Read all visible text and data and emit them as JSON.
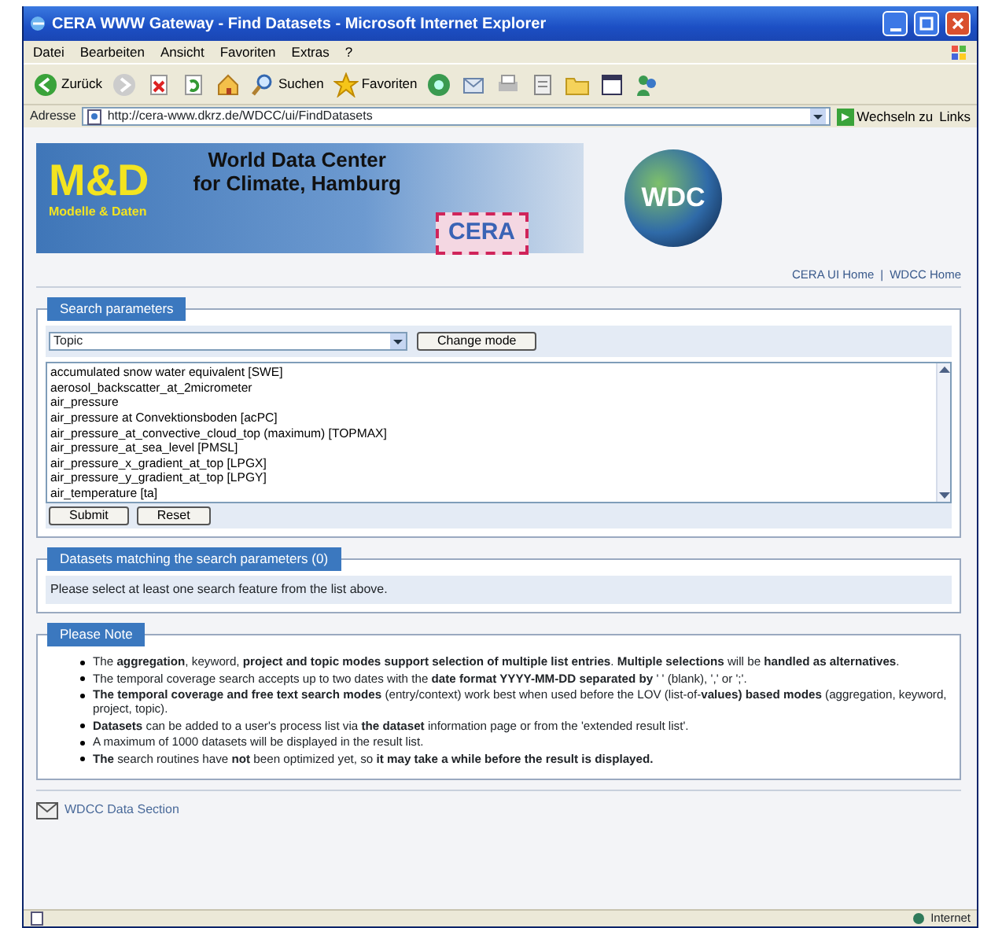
{
  "window": {
    "title": "CERA WWW Gateway - Find Datasets - Microsoft Internet Explorer",
    "menu": [
      "Datei",
      "Bearbeiten",
      "Ansicht",
      "Favoriten",
      "Extras",
      "?"
    ],
    "toolbar": [
      {
        "kind": "back",
        "label": "Zurück"
      },
      {
        "kind": "forward"
      },
      {
        "kind": "stop"
      },
      {
        "kind": "refresh"
      },
      {
        "kind": "home"
      },
      {
        "kind": "search",
        "label": "Suchen"
      },
      {
        "kind": "favorites",
        "label": "Favoriten"
      },
      {
        "kind": "media"
      },
      {
        "kind": "mail"
      },
      {
        "kind": "print"
      },
      {
        "kind": "edit"
      },
      {
        "kind": "folder"
      },
      {
        "kind": "window"
      },
      {
        "kind": "messenger"
      }
    ],
    "address": {
      "label": "Adresse",
      "url": "http://cera-www.dkrz.de/WDCC/ui/FindDatasets",
      "go": "Wechseln zu",
      "links": "Links"
    }
  },
  "banner": {
    "logo": "M&D",
    "logo_sub": "Modelle & Daten",
    "title_lines": [
      "World Data Center",
      "for Climate, Hamburg"
    ],
    "cera": "CERA",
    "wdc": "WDC"
  },
  "header_links": [
    "CERA UI Home",
    "WDCC Home"
  ],
  "header_link_separator": "|",
  "search": {
    "legend": "Search parameters",
    "mode": "Topic",
    "change_mode": "Change mode",
    "options": [
      {
        "label": "accumulated snow water equivalent [SWE]",
        "selected": false
      },
      {
        "label": "aerosol_backscatter_at_2micrometer",
        "selected": false
      },
      {
        "label": "air_pressure",
        "selected": false
      },
      {
        "label": "air_pressure at Convektionsboden [acPC]",
        "selected": false
      },
      {
        "label": "air_pressure_at_convective_cloud_top (maximum) [TOPMAX]",
        "selected": false
      },
      {
        "label": "air_pressure_at_sea_level [PMSL]",
        "selected": false
      },
      {
        "label": "air_pressure_x_gradient_at_top [LPGX]",
        "selected": false
      },
      {
        "label": "air_pressure_y_gradient_at_top [LPGY]",
        "selected": false
      },
      {
        "label": "air_temperature [ta]",
        "selected": false
      }
    ],
    "buttons": [
      "Submit",
      "Reset"
    ]
  },
  "results": {
    "legend": "Datasets matching the search parameters (0)",
    "message": "Please select at least one search feature from the list above."
  },
  "note": {
    "legend": "Please Note",
    "items": [
      "The **aggregation**, keyword, **project and topic modes support selection of multiple list entries**. **Multiple selections** will be **handled as alternatives**.",
      "The temporal coverage search accepts up to two dates with the **date format YYYY-MM-DD separated by** ' ' (blank), ',' or ';'.",
      "**The temporal coverage and free text search modes** (entry/context) work best when used before the LOV (list-of-**values) based modes** (aggregation, keyword, project, topic).",
      "**Datasets** can be added to a user's process list via **the dataset** information page or from the 'extended result list'.",
      "A maximum of 1000 datasets will be displayed in the result list.",
      "**The** search routines have **not** been optimized yet, so **it may take a while before the result is displayed.**"
    ]
  },
  "footer": {
    "link": "WDCC Data Section"
  },
  "status_bar": {
    "zone": "Internet"
  }
}
